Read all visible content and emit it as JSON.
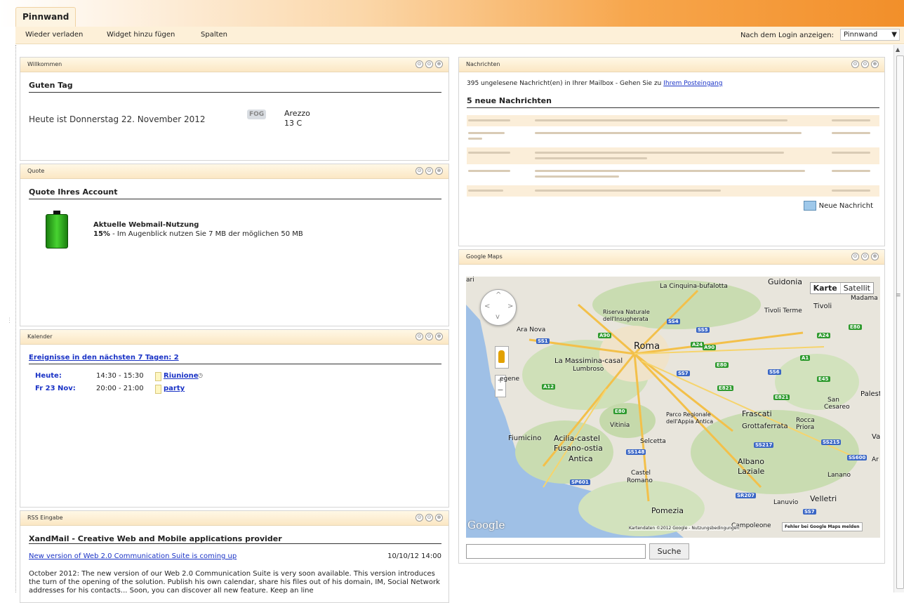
{
  "tab": {
    "label": "Pinnwand"
  },
  "toolbar": {
    "items": [
      "Wieder verladen",
      "Widget hinzu fügen",
      "Spalten"
    ],
    "login_label": "Nach dem Login anzeigen:",
    "login_value": "Pinnwand"
  },
  "welcome": {
    "title": "Willkommen",
    "greeting": "Guten Tag",
    "date": "Heute ist Donnerstag 22. November 2012",
    "weather_badge": "FOG",
    "city": "Arezzo",
    "temp": "13 C"
  },
  "quota": {
    "title": "Quote",
    "heading": "Quote Ihres Account",
    "usage_title": "Aktuelle Webmail-Nutzung",
    "usage_percent": "15%",
    "usage_text": " - Im Augenblick nutzen Sie 7 MB der möglichen 50 MB"
  },
  "calendar": {
    "title": "Kalender",
    "events_link": "Ereignisse in den nächsten 7 Tagen: 2",
    "events": [
      {
        "day": "Heute:",
        "time": "14:30 - 15:30",
        "title": "Riunione"
      },
      {
        "day": "Fr 23 Nov:",
        "time": "20:00 - 21:00",
        "title": "party"
      }
    ]
  },
  "rss": {
    "title": "RSS Eingabe",
    "feed_title": "XandMail - Creative Web and Mobile applications provider",
    "item_link": "New version of Web 2.0 Communication Suite is coming up",
    "item_date": "10/10/12 14:00",
    "item_body": "October 2012: The new version of our Web 2.0 Communication Suite is very soon available. This version introduces the turn of the opening of the solution. Publish his own calendar, share his files out of his domain, IM, Social Network addresses for his contacts... Soon, you can discover all new feature. Keep an line"
  },
  "messages": {
    "title": "Nachrichten",
    "count_text": "395 ungelesene Nachricht(en) in Ihrer Mailbox - Gehen Sie zu ",
    "count_link": "Ihrem Posteingang",
    "heading": "5 neue Nachrichten",
    "new_label": "Neue Nachricht"
  },
  "maps": {
    "title": "Google Maps",
    "btn_map": "Karte",
    "btn_sat": "Satellit",
    "logo": "Google",
    "footer": "Kartendaten ©2012 Google - Nutzungsbedingungen",
    "report": "Fehler bei Google Maps melden",
    "search_button": "Suche",
    "places": [
      "ari",
      "La Cinquina-bufalotta",
      "Guidonia",
      "Madama",
      "Tivoli Terme",
      "Tivoli",
      "Riserva Naturale",
      "dell'Insugherata",
      "Ara Nova",
      "Roma",
      "La Massimina-casal",
      "Lumbroso",
      "egene",
      "Parco Regionale",
      "dell'Appia Antica",
      "Frascati",
      "San",
      "Cesareo",
      "Palestr",
      "Vitinia",
      "Grottaferrata",
      "Rocca",
      "Priora",
      "Fiumicino",
      "Acilia-castel",
      "Fusano-ostia",
      "Antica",
      "Selcetta",
      "Albano",
      "Laziale",
      "Lanano",
      "Castel",
      "Romano",
      "Velletri",
      "Lanuvio",
      "Pomezia",
      "Campoleone",
      "Val",
      "Ar"
    ],
    "roads": [
      "SS4",
      "SS5",
      "A90",
      "A24",
      "A90",
      "SS1",
      "E80",
      "A1",
      "SS7",
      "SS6",
      "E45",
      "A12",
      "E821",
      "E821",
      "E80",
      "SS217",
      "SS215",
      "SS148",
      "SS600",
      "SP601",
      "SR207",
      "SS7",
      "E80",
      "A24"
    ]
  },
  "icons": {
    "up_arrow": "▲",
    "down_arrow": "▼",
    "collapse": "⊙",
    "close": "⊕"
  },
  "colors": {
    "accent_orange": "#f28f2a",
    "link_blue": "#1a33c6",
    "header_cream": "#fbe7c4"
  }
}
